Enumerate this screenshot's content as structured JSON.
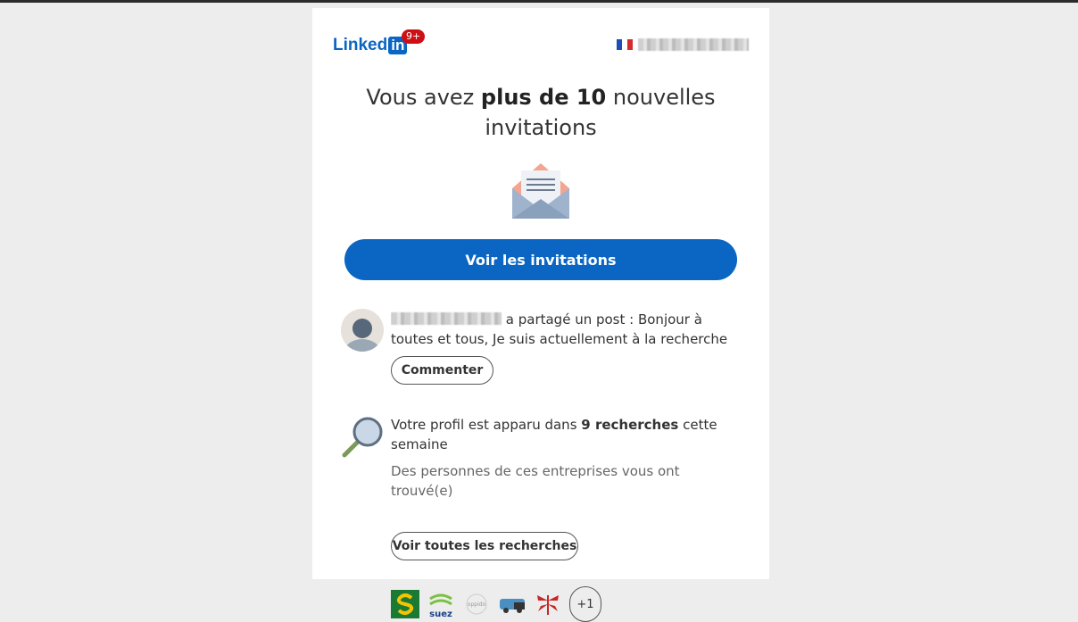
{
  "header": {
    "logo_text": "Linked",
    "logo_in": "in",
    "notification_badge": "9+",
    "locale_flag": "France"
  },
  "hero": {
    "title_prefix": "Vous avez ",
    "title_bold": "plus de 10",
    "title_suffix": " nouvelles invitations",
    "envelope_icon": "envelope-icon",
    "cta_label": "Voir les invitations"
  },
  "post_item": {
    "action_text": " a partagé un post : Bonjour à toutes et tous, Je suis actuellement à la recherche d’un stage en",
    "button_label": "Commenter"
  },
  "search_item": {
    "text_prefix": "Votre profil est apparu dans ",
    "text_bold": "9 recherches",
    "text_suffix": " cette semaine",
    "subtitle": "Des personnes de ces entreprises vous ont trouvé(e)",
    "companies": [
      "Subway",
      "Suez",
      "Oppido",
      "Entreprise 4",
      "Entreprise 5"
    ],
    "more_count": "+1",
    "button_label": "Voir toutes les recherches"
  },
  "colors": {
    "brand_blue": "#0a66c2",
    "badge_red": "#cc1016",
    "background": "#ededed"
  }
}
